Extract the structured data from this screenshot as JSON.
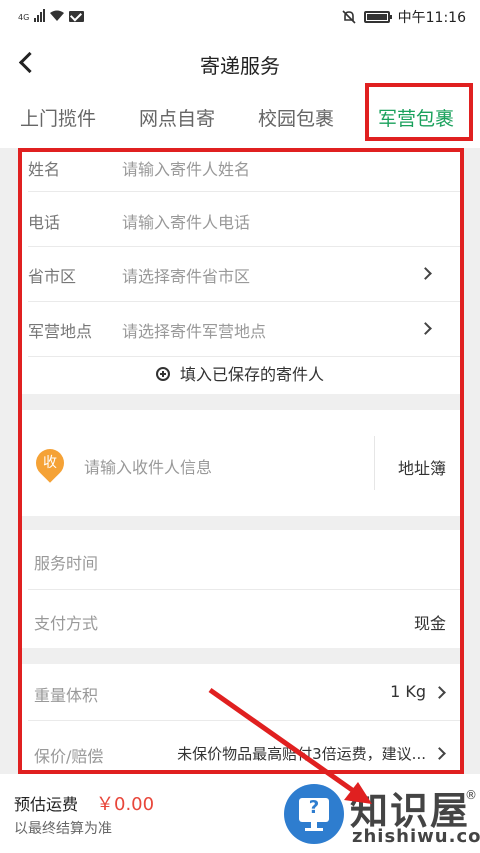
{
  "status_bar": {
    "network": "4G",
    "time": "中午11:16"
  },
  "header": {
    "back_icon": "chevron-left-icon",
    "title": "寄递服务"
  },
  "tabs": [
    {
      "label": "上门揽件",
      "active": false
    },
    {
      "label": "网点自寄",
      "active": false
    },
    {
      "label": "校园包裹",
      "active": false
    },
    {
      "label": "军营包裹",
      "active": true
    }
  ],
  "sender": {
    "name": {
      "label": "姓名",
      "placeholder": "请输入寄件人姓名"
    },
    "phone": {
      "label": "电话",
      "placeholder": "请输入寄件人电话"
    },
    "region": {
      "label": "省市区",
      "placeholder": "请选择寄件省市区"
    },
    "camp": {
      "label": "军营地点",
      "placeholder": "请选择寄件军营地点"
    },
    "fill_saved": "填入已保存的寄件人"
  },
  "receiver": {
    "badge": "收",
    "placeholder": "请输入收件人信息",
    "address_book": "地址簿"
  },
  "service": {
    "time_label": "服务时间",
    "payment_label": "支付方式",
    "payment_value": "现金"
  },
  "package": {
    "weight_label": "重量体积",
    "weight_value": "1 Kg",
    "insurance_label": "保价/赔偿",
    "insurance_value": "未保价物品最高赔付3倍运费，建议..."
  },
  "footer": {
    "estimate_label": "预估运费",
    "estimate_value": "￥0.00",
    "estimate_note": "以最终结算为准"
  },
  "watermark": {
    "brand": "知识屋",
    "registered": "®",
    "domain": "zhishiwu.com"
  },
  "colors": {
    "accent_green": "#1aa15c",
    "highlight_red": "#e02020",
    "price_red": "#e8463a",
    "receiver_orange": "#f5a236"
  }
}
